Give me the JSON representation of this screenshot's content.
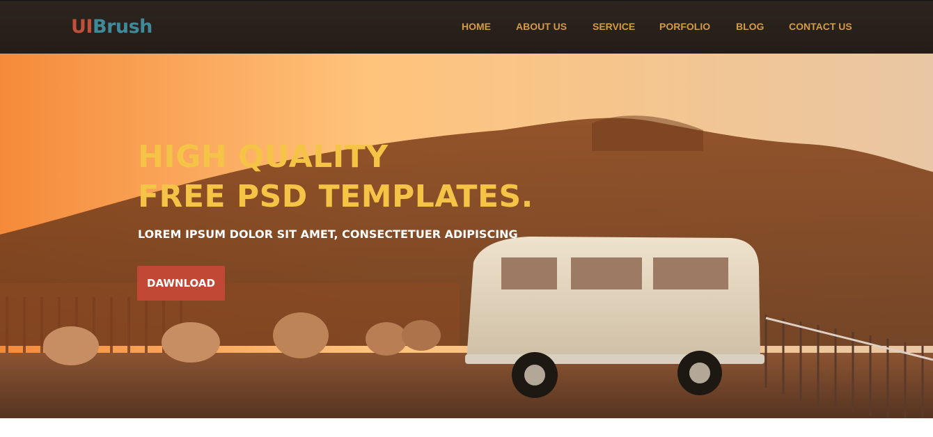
{
  "header": {
    "logo_part1": "UI",
    "logo_part2": "Brush",
    "nav": [
      "HOME",
      "ABOUT US",
      "SERVICE",
      "PORFOLIO",
      "BLOG",
      "CONTACT US"
    ]
  },
  "hero": {
    "title_line1": "HIGH QUALITY",
    "title_line2": "FREE PSD TEMPLATES.",
    "subtitle": "LOREM IPSUM DOLOR SIT AMET, CONSECTETUER ADIPISCING",
    "cta_label": "DAWNLOAD"
  },
  "colors": {
    "topbar": "#2d241e",
    "logo_ui": "#c0503a",
    "logo_brush": "#3f8a9a",
    "nav_text": "#d59a43",
    "title": "#f5c346",
    "cta": "#c24836"
  },
  "background": {
    "description": "sunset photo of a parked vintage van beside a wooden fence"
  }
}
